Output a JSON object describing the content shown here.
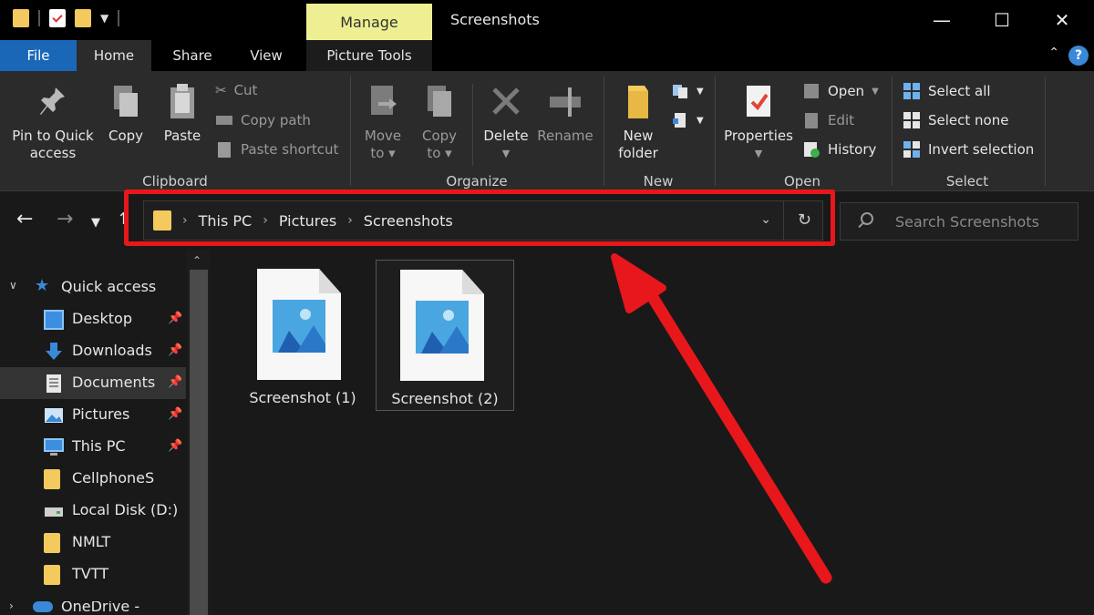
{
  "window": {
    "title": "Screenshots",
    "contextual_tab": "Manage",
    "controls": {
      "minimize": "—",
      "maximize": "☐",
      "close": "✕"
    }
  },
  "tabs": {
    "file": "File",
    "home": "Home",
    "share": "Share",
    "view": "View",
    "picture_tools": "Picture Tools"
  },
  "help_icon": "?",
  "ribbon": {
    "clipboard": {
      "label": "Clipboard",
      "pin_line1": "Pin to Quick",
      "pin_line2": "access",
      "copy": "Copy",
      "paste": "Paste",
      "cut": "Cut",
      "copy_path": "Copy path",
      "paste_shortcut": "Paste shortcut"
    },
    "organize": {
      "label": "Organize",
      "move_line1": "Move",
      "move_line2": "to",
      "copy_line1": "Copy",
      "copy_line2": "to",
      "delete": "Delete",
      "rename": "Rename"
    },
    "new": {
      "label": "New",
      "folder_line1": "New",
      "folder_line2": "folder"
    },
    "open": {
      "label": "Open",
      "properties": "Properties",
      "open": "Open",
      "edit": "Edit",
      "history": "History"
    },
    "select": {
      "label": "Select",
      "select_all": "Select all",
      "select_none": "Select none",
      "invert": "Invert selection"
    }
  },
  "address": {
    "crumbs": [
      "This PC",
      "Pictures",
      "Screenshots"
    ],
    "search_placeholder": "Search Screenshots"
  },
  "nav": {
    "quick_access": "Quick access",
    "items": [
      {
        "label": "Desktop",
        "icon": "desktop-icon",
        "pinned": true
      },
      {
        "label": "Downloads",
        "icon": "download-icon",
        "pinned": true
      },
      {
        "label": "Documents",
        "icon": "documents-icon",
        "pinned": true
      },
      {
        "label": "Pictures",
        "icon": "pictures-icon",
        "pinned": true
      },
      {
        "label": "This PC",
        "icon": "computer-icon",
        "pinned": true
      },
      {
        "label": "CellphoneS",
        "icon": "folder-icon",
        "pinned": false
      },
      {
        "label": "Local Disk (D:)",
        "icon": "drive-icon",
        "pinned": false
      },
      {
        "label": "NMLT",
        "icon": "folder-icon",
        "pinned": false
      },
      {
        "label": "TVTT",
        "icon": "folder-icon",
        "pinned": false
      }
    ],
    "onedrive": "OneDrive - Person"
  },
  "files": [
    {
      "name": "Screenshot (1)",
      "selected": false
    },
    {
      "name": "Screenshot (2)",
      "selected": true
    }
  ],
  "colors": {
    "accent_blue": "#1a67b7",
    "manage_tab": "#eeef92",
    "annotation_red": "#e8171c",
    "folder_yellow": "#f4c95d"
  }
}
